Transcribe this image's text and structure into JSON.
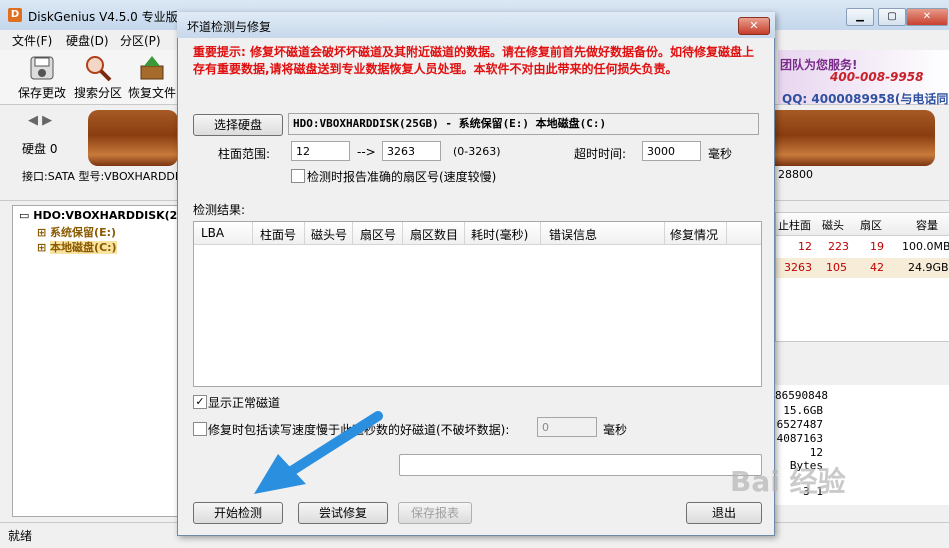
{
  "app": {
    "icon_letter": "D",
    "title": "DiskGenius V4.5.0 专业版"
  },
  "menu": [
    "文件(F)",
    "硬盘(D)",
    "分区(P)"
  ],
  "toolbar": [
    {
      "label": "保存更改",
      "icon": "save-icon"
    },
    {
      "label": "搜索分区",
      "icon": "search-icon"
    },
    {
      "label": "恢复文件",
      "icon": "restore-icon"
    }
  ],
  "banner": {
    "line1": "团队为您服务!",
    "line2": "400-008-9958",
    "line3": "QQ: 4000089958(与电话同号"
  },
  "disk_panel": {
    "nav": "◀ ▶",
    "disk_label": "硬盘 0",
    "interface": "接口:SATA  型号:VBOXHARDDI",
    "right_info": "28800"
  },
  "tree": {
    "disk": "HDO:VBOXHARDDISK(2",
    "part1": "系统保留(E:)",
    "part2": "本地磁盘(C:)"
  },
  "right_table": {
    "headers": [
      "止柱面",
      "磁头",
      "扇区",
      "容量"
    ],
    "rows": [
      [
        "12",
        "223",
        "19",
        "100.0MB"
      ],
      [
        "3263",
        "105",
        "42",
        "24.9GB"
      ]
    ]
  },
  "right_info": [
    "86590848",
    "15.6GB",
    "6527487",
    "4087163",
    "12 Bytes",
    "3 1"
  ],
  "status": "就绪",
  "dialog": {
    "title": "坏道检测与修复",
    "close": "✕",
    "warning": "重要提示: 修复坏磁道会破坏坏磁道及其附近磁道的数据。请在修复前首先做好数据备份。如待修复磁盘上存有重要数据,请将磁盘送到专业数据恢复人员处理。本软件不对由此带来的任何损失负责。",
    "select_disk_button": "选择硬盘",
    "disk_name": "HDO:VBOXHARDDISK(25GB) - 系统保留(E:) 本地磁盘(C:)",
    "cylinder_label": "柱面范围:",
    "cyl_from": "12",
    "cyl_arrow": "-->",
    "cyl_to": "3263",
    "cyl_range": "(0-3263)",
    "timeout_label": "超时时间:",
    "timeout_value": "3000",
    "timeout_unit": "毫秒",
    "report_sector_label": "检测时报告准确的扇区号(速度较慢)",
    "results_label": "检测结果:",
    "columns": [
      "LBA",
      "柱面号",
      "磁头号",
      "扇区号",
      "扇区数目",
      "耗时(毫秒)",
      "错误信息",
      "修复情况"
    ],
    "show_normal_label": "显示正常磁道",
    "show_normal_checked": true,
    "slow_repair_label": "修复时包括读写速度慢于此毫秒数的好磁道(不破坏数据):",
    "slow_value": "0",
    "slow_unit": "毫秒",
    "start_button": "开始检测",
    "repair_button": "尝试修复",
    "save_report_button": "保存报表",
    "exit_button": "退出",
    "watermark": "Bai 经验"
  },
  "colors": {
    "warning": "#e01010",
    "arrow": "#2b8fe0"
  }
}
